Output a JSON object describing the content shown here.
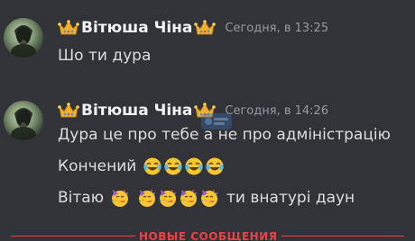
{
  "messages": [
    {
      "username": "Вітюша Чіна",
      "timestamp": "Сегодня, в 13:25",
      "lines": [
        {
          "text": "Шо ти дура"
        }
      ]
    },
    {
      "username": "Вітюша Чіна",
      "timestamp": "Сегодня, в 14:26",
      "lines": [
        {
          "text": "Дура це про тебе а не про адміністрацію"
        },
        {
          "text": "Кончений",
          "emojis": [
            "tears-of-joy",
            "tears-of-joy",
            "tears-of-joy",
            "tears-of-joy"
          ]
        },
        {
          "text_before": "Вітаю",
          "emojis": [
            "partying-face",
            "partying-face",
            "partying-face",
            "partying-face",
            "partying-face"
          ],
          "text_after": "ти внатурі даун"
        }
      ]
    }
  ],
  "divider": {
    "label": "НОВЫЕ СООБЩЕНИЯ"
  },
  "colors": {
    "background": "#313338",
    "username": "#f2f3f5",
    "message_text": "#dbdee1",
    "timestamp": "#949ba4",
    "new_messages": "#f23f43",
    "crown": "#f0b232"
  }
}
